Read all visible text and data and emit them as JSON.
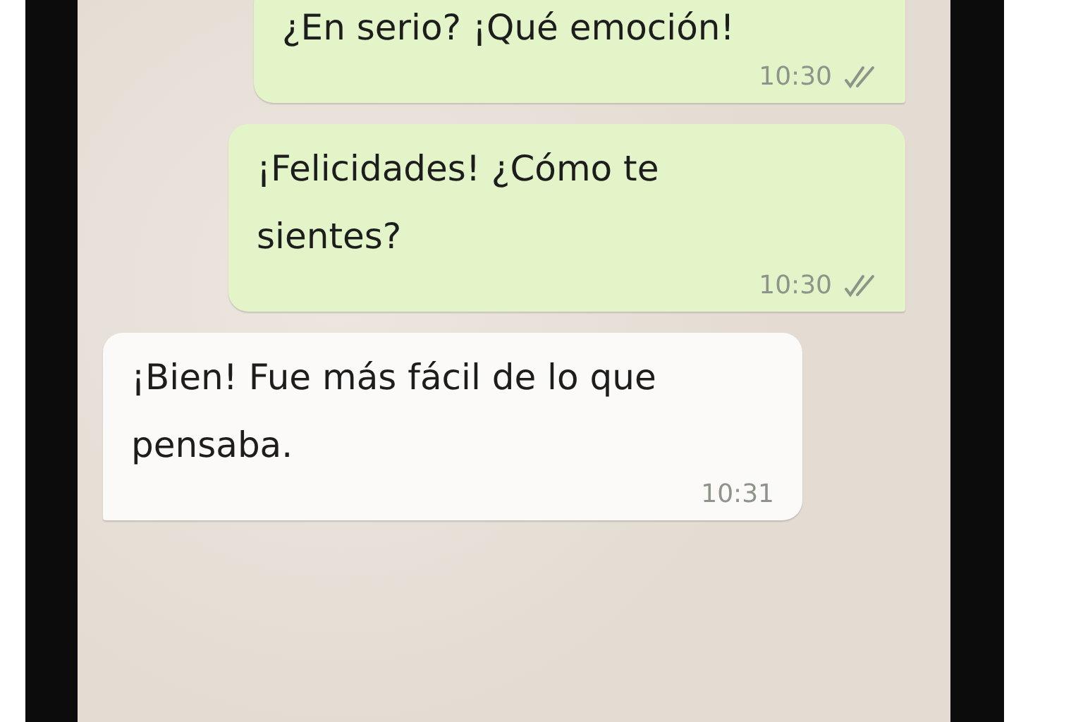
{
  "messages": [
    {
      "kind": "sent",
      "text": "¿En serio? ¡Qué emoción!",
      "time": "10:30",
      "read": false
    },
    {
      "kind": "sent",
      "text": "¡Felicidades! ¿Cómo te sientes?",
      "time": "10:30",
      "read": false
    },
    {
      "kind": "received",
      "text": "¡Bien! Fue más fácil de lo que pensaba.",
      "time": "10:31"
    }
  ]
}
